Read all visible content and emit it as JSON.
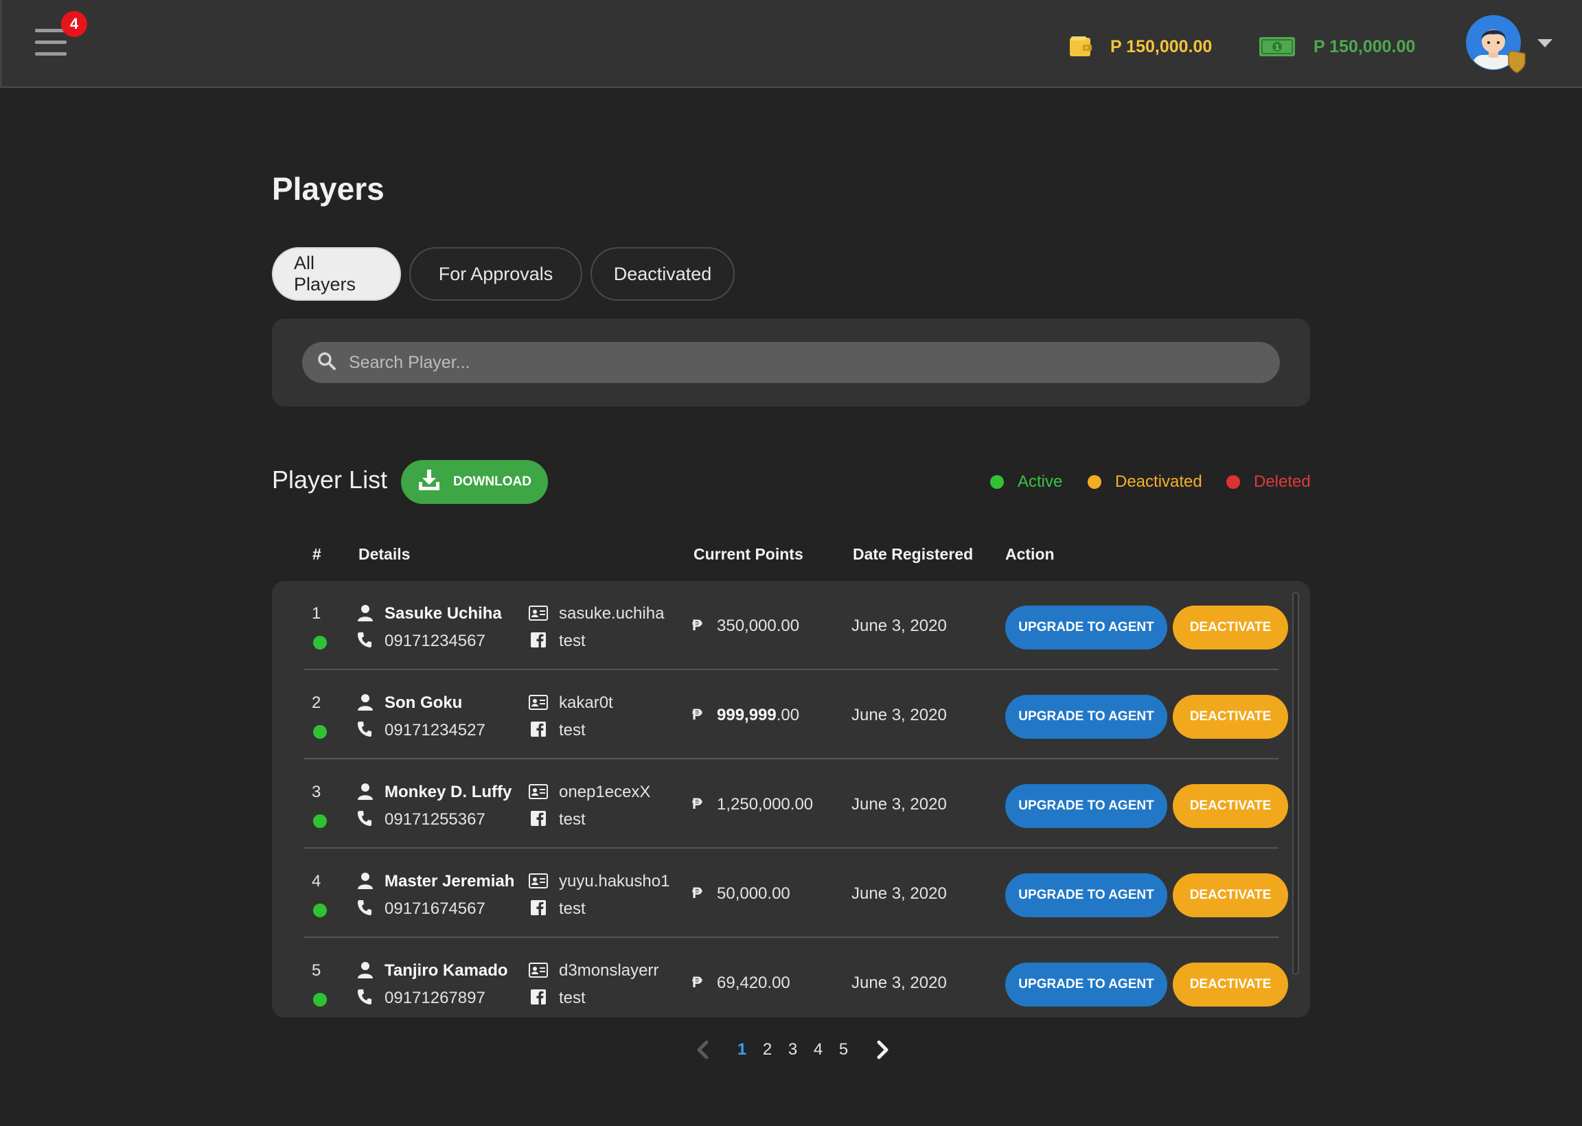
{
  "header": {
    "notification_count": "4",
    "wallet_balance": "P 150,000.00",
    "cash_balance": "P 150,000.00"
  },
  "page": {
    "title": "Players",
    "tabs": [
      {
        "label": "All Players",
        "active": true
      },
      {
        "label": "For Approvals",
        "active": false
      },
      {
        "label": "Deactivated",
        "active": false
      }
    ],
    "search_placeholder": "Search Player..."
  },
  "player_list": {
    "title": "Player List",
    "download_label": "DOWNLOAD",
    "legend": {
      "active": "Active",
      "deactivated": "Deactivated",
      "deleted": "Deleted"
    },
    "columns": [
      "#",
      "Details",
      "Current Points",
      "Date Registered",
      "Action"
    ],
    "upgrade_label": "UPGRADE TO AGENT",
    "deactivate_label": "DEACTIVATE",
    "rows": [
      {
        "num": "1",
        "name": "Sasuke Uchiha",
        "phone": "09171234567",
        "username": "sasuke.uchiha",
        "facebook": "test",
        "points_main": "350,000.00",
        "points_rest": "",
        "date": "June 3, 2020",
        "status": "active"
      },
      {
        "num": "2",
        "name": "Son Goku",
        "phone": "09171234527",
        "username": "kakar0t",
        "facebook": "test",
        "points_main": "999,999",
        "points_rest": ".00",
        "date": "June 3, 2020",
        "status": "active"
      },
      {
        "num": "3",
        "name": "Monkey D. Luffy",
        "phone": "09171255367",
        "username": "onep1ecexX",
        "facebook": "test",
        "points_main": "1,250,000.00",
        "points_rest": "",
        "date": "June 3, 2020",
        "status": "active"
      },
      {
        "num": "4",
        "name": "Master Jeremiah",
        "phone": "09171674567",
        "username": "yuyu.hakusho1",
        "facebook": "test",
        "points_main": "",
        "points_rest": "50,000.00",
        "date": "June 3, 2020",
        "status": "active"
      },
      {
        "num": "5",
        "name": "Tanjiro Kamado",
        "phone": "09171267897",
        "username": "d3monslayerr",
        "facebook": "test",
        "points_main": "",
        "points_rest": "69,420.00",
        "date": "June 3, 2020",
        "status": "active"
      }
    ]
  },
  "pagination": {
    "pages": [
      "1",
      "2",
      "3",
      "4",
      "5"
    ],
    "current": "1"
  },
  "colors": {
    "active": "#33c234",
    "deactivated": "#f3ad22",
    "deleted": "#dc3232",
    "upgrade_button": "#2278c6",
    "download_button": "#3fa646"
  }
}
